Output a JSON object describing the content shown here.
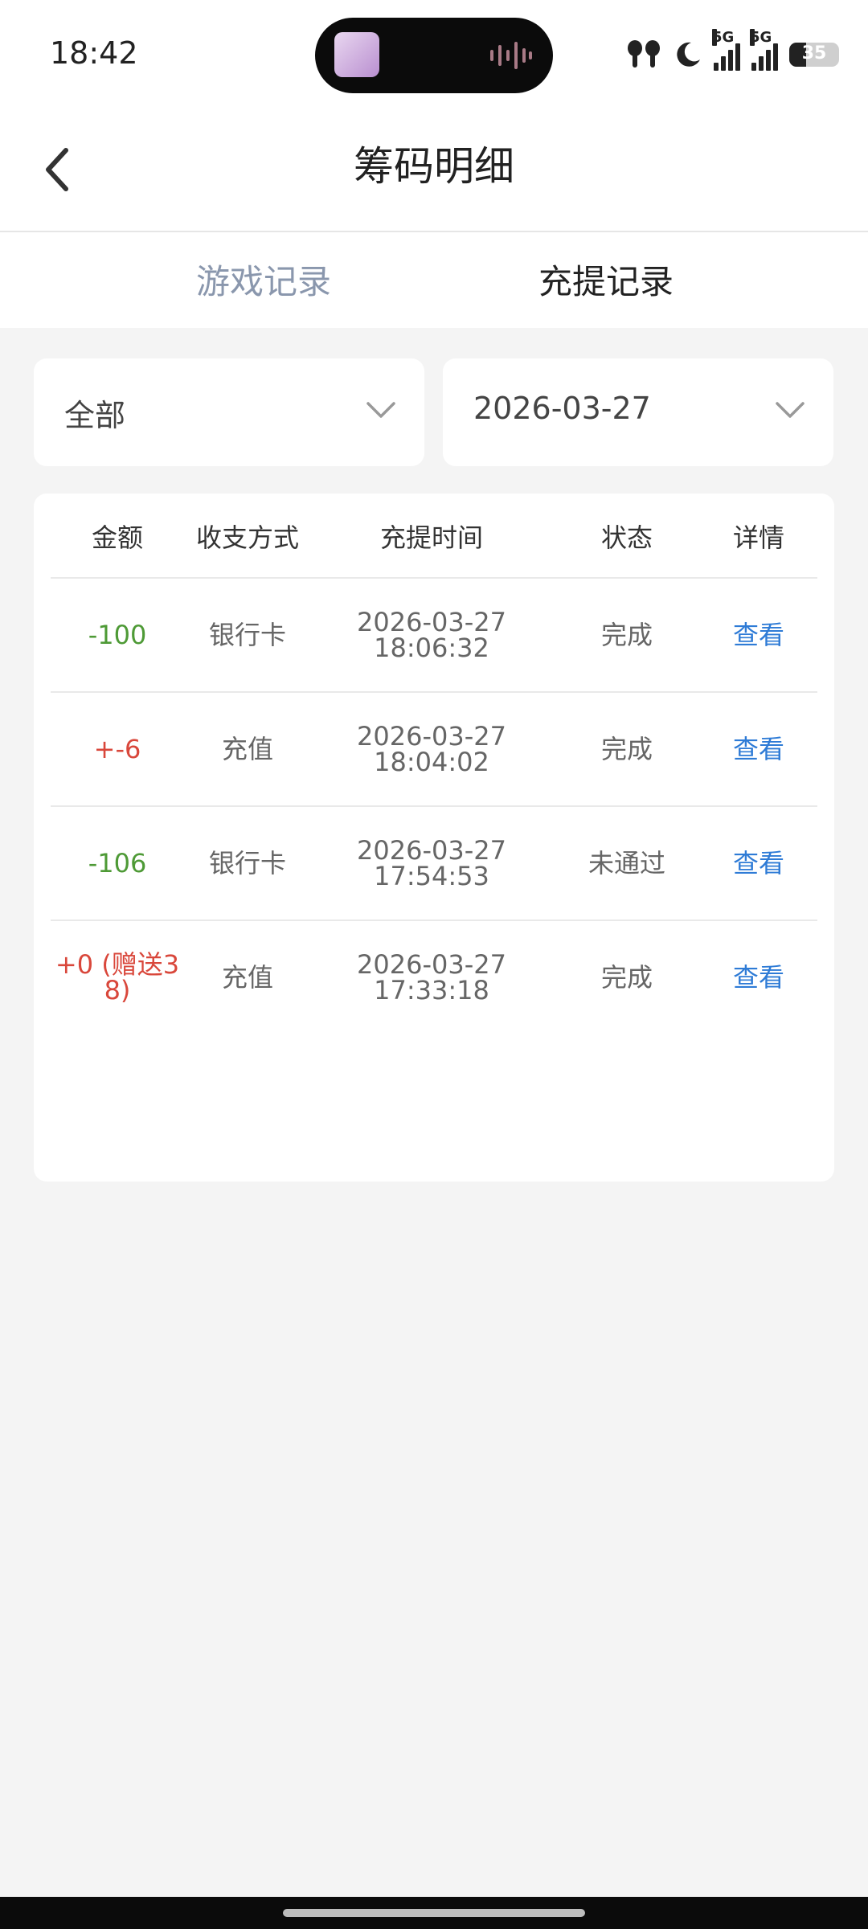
{
  "status_bar": {
    "time": "18:42",
    "net1": "5G",
    "net2": "5G",
    "battery": "35"
  },
  "header": {
    "title": "筹码明细"
  },
  "tabs": [
    {
      "label": "游戏记录",
      "active": false
    },
    {
      "label": "充提记录",
      "active": true
    }
  ],
  "filters": {
    "type_value": "全部",
    "date_value": "2026-03-27"
  },
  "table": {
    "columns": [
      "金额",
      "收支方式",
      "充提时间",
      "状态",
      "详情"
    ],
    "rows": [
      {
        "amount": "-100",
        "amount_color": "#4e9a36",
        "method": "银行卡",
        "date": "2026-03-27",
        "time": "18:06:32",
        "status": "完成",
        "detail": "查看"
      },
      {
        "amount": "+-6",
        "amount_color": "#d9473b",
        "method": "充值",
        "date": "2026-03-27",
        "time": "18:04:02",
        "status": "完成",
        "detail": "查看"
      },
      {
        "amount": "-106",
        "amount_color": "#4e9a36",
        "method": "银行卡",
        "date": "2026-03-27",
        "time": "17:54:53",
        "status": "未通过",
        "detail": "查看"
      },
      {
        "amount_line1": "+0 (赠送3",
        "amount_line2": "8)",
        "amount_color": "#d9473b",
        "method": "充值",
        "date": "2026-03-27",
        "time": "17:33:18",
        "status": "完成",
        "detail": "查看"
      }
    ]
  },
  "colors": {
    "link": "#2e7bd6",
    "negative": "#4e9a36",
    "positive": "#d9473b",
    "tab_inactive": "#8a97ad"
  }
}
